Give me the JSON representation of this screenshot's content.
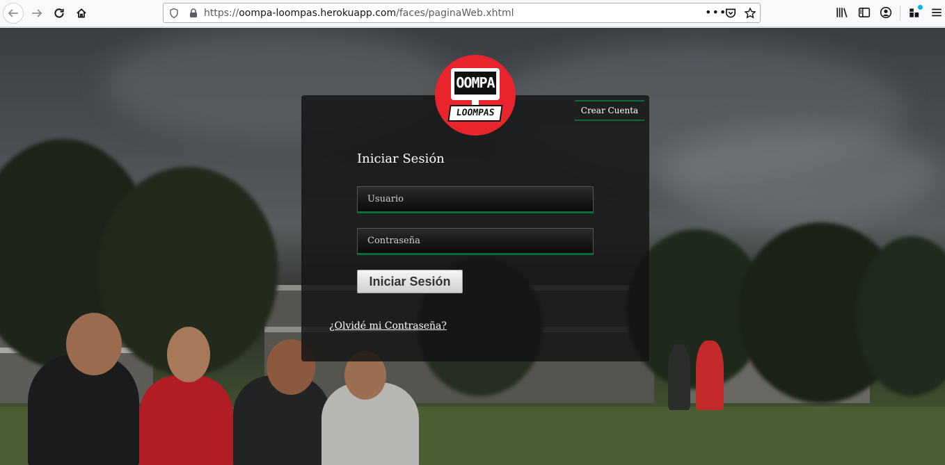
{
  "browser": {
    "url_prefix": "https://",
    "url_host": "oompa-loompas.herokuapp.com",
    "url_path": "/faces/paginaWeb.xhtml",
    "more_label": "•••"
  },
  "logo": {
    "top_text": "OOMPA",
    "bottom_text": "LOOMPAS"
  },
  "login": {
    "create_account": "Crear Cuenta",
    "title": "Iniciar Sesión",
    "user_placeholder": "Usuario",
    "password_placeholder": "Contraseña",
    "submit_label": "Iniciar Sesión",
    "forgot_link": "¿Olvidé mi Contraseña?"
  },
  "colors": {
    "logo_red": "#e8242c",
    "accent_green": "#0a6b3a",
    "panel_bg": "#121212"
  }
}
